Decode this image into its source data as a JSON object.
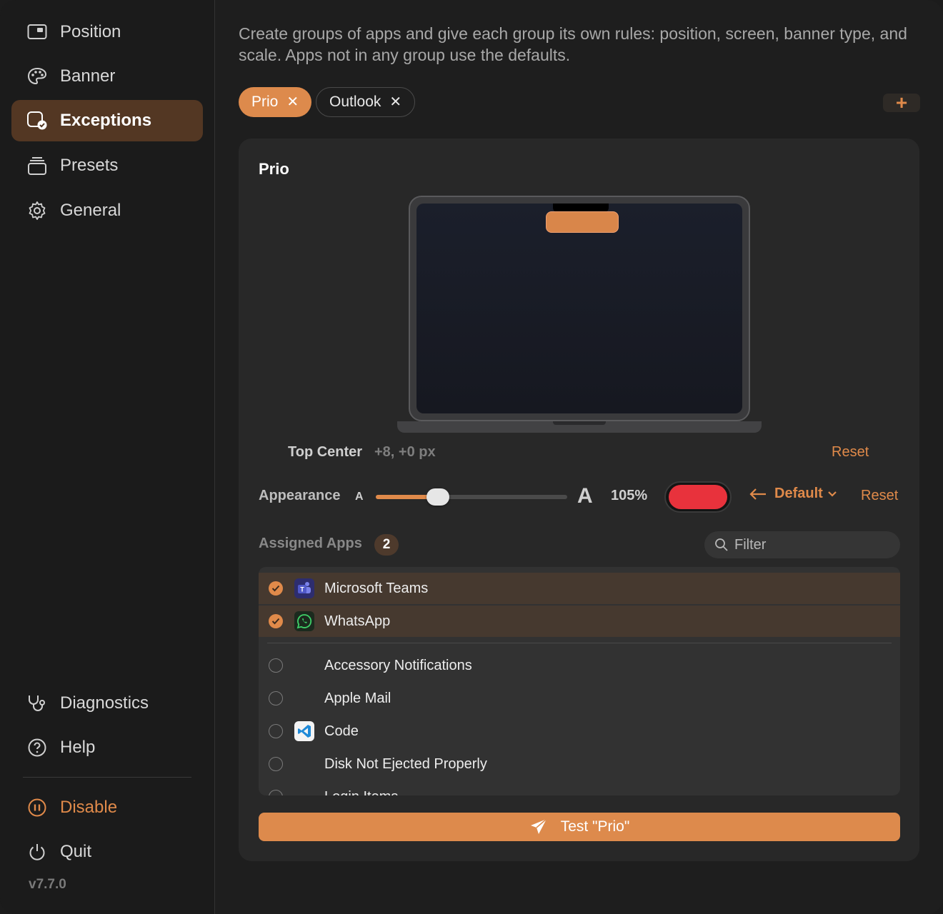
{
  "sidebar": {
    "items": [
      {
        "label": "Position",
        "icon": "window-icon"
      },
      {
        "label": "Banner",
        "icon": "palette-icon"
      },
      {
        "label": "Exceptions",
        "icon": "exceptions-icon",
        "active": true
      },
      {
        "label": "Presets",
        "icon": "stack-icon"
      },
      {
        "label": "General",
        "icon": "gear-icon"
      }
    ],
    "bottom_items": [
      {
        "label": "Diagnostics",
        "icon": "stethoscope-icon"
      },
      {
        "label": "Help",
        "icon": "question-icon"
      }
    ],
    "disable_label": "Disable",
    "quit_label": "Quit",
    "version": "v7.7.0"
  },
  "main": {
    "description": "Create groups of apps and give each group its own rules: position, screen, banner type, and scale. Apps not in any group use the defaults.",
    "groups": [
      {
        "label": "Prio",
        "selected": true
      },
      {
        "label": "Outlook",
        "selected": false
      }
    ],
    "add_label": "+",
    "panel": {
      "title": "Prio",
      "position_label": "Top Center",
      "position_offset": "+8, +0 px",
      "reset_label": "Reset",
      "appearance_label": "Appearance",
      "a_small": "A",
      "a_big": "A",
      "scale_value": "105%",
      "scale_fraction": 0.3,
      "banner_color": "#e8323c",
      "default_label": "Default",
      "assigned_label": "Assigned Apps",
      "assigned_count": "2",
      "filter_placeholder": "Filter",
      "apps_checked": [
        {
          "name": "Microsoft Teams",
          "icon": "teams-icon"
        },
        {
          "name": "WhatsApp",
          "icon": "whatsapp-icon"
        }
      ],
      "apps_unchecked": [
        {
          "name": "Accessory Notifications",
          "icon": ""
        },
        {
          "name": "Apple Mail",
          "icon": ""
        },
        {
          "name": "Code",
          "icon": "vscode-icon"
        },
        {
          "name": "Disk Not Ejected Properly",
          "icon": ""
        },
        {
          "name": "Login Items",
          "icon": ""
        }
      ],
      "test_label": "Test \"Prio\""
    }
  },
  "colors": {
    "accent": "#e08a4a",
    "active_nav": "#533723"
  }
}
